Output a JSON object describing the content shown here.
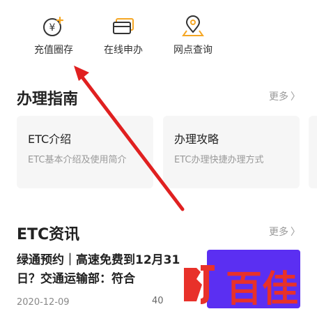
{
  "quick_actions": [
    {
      "label": "充值圈存",
      "icon": "yuan-recharge-icon"
    },
    {
      "label": "在线申办",
      "icon": "card-apply-icon"
    },
    {
      "label": "网点查询",
      "icon": "location-pin-icon"
    }
  ],
  "guide": {
    "title": "办理指南",
    "more": "更多",
    "cards": [
      {
        "title": "ETC介绍",
        "desc": "ETC基本介绍及使用简介"
      },
      {
        "title": "办理攻略",
        "desc": "ETC办理快捷办理方式"
      }
    ]
  },
  "news": {
    "title": "ETC资讯",
    "more": "更多",
    "items": [
      {
        "title": "绿通预约｜高速免费到12月31日？交通运输部：符合",
        "date": "2020-12-09",
        "count": "40"
      }
    ]
  },
  "watermark": {
    "text": "百佳"
  },
  "colors": {
    "accent": "#f5a623",
    "arrow": "#e02020",
    "thumb": "#5b2ff2",
    "watermark": "#e8312a"
  }
}
